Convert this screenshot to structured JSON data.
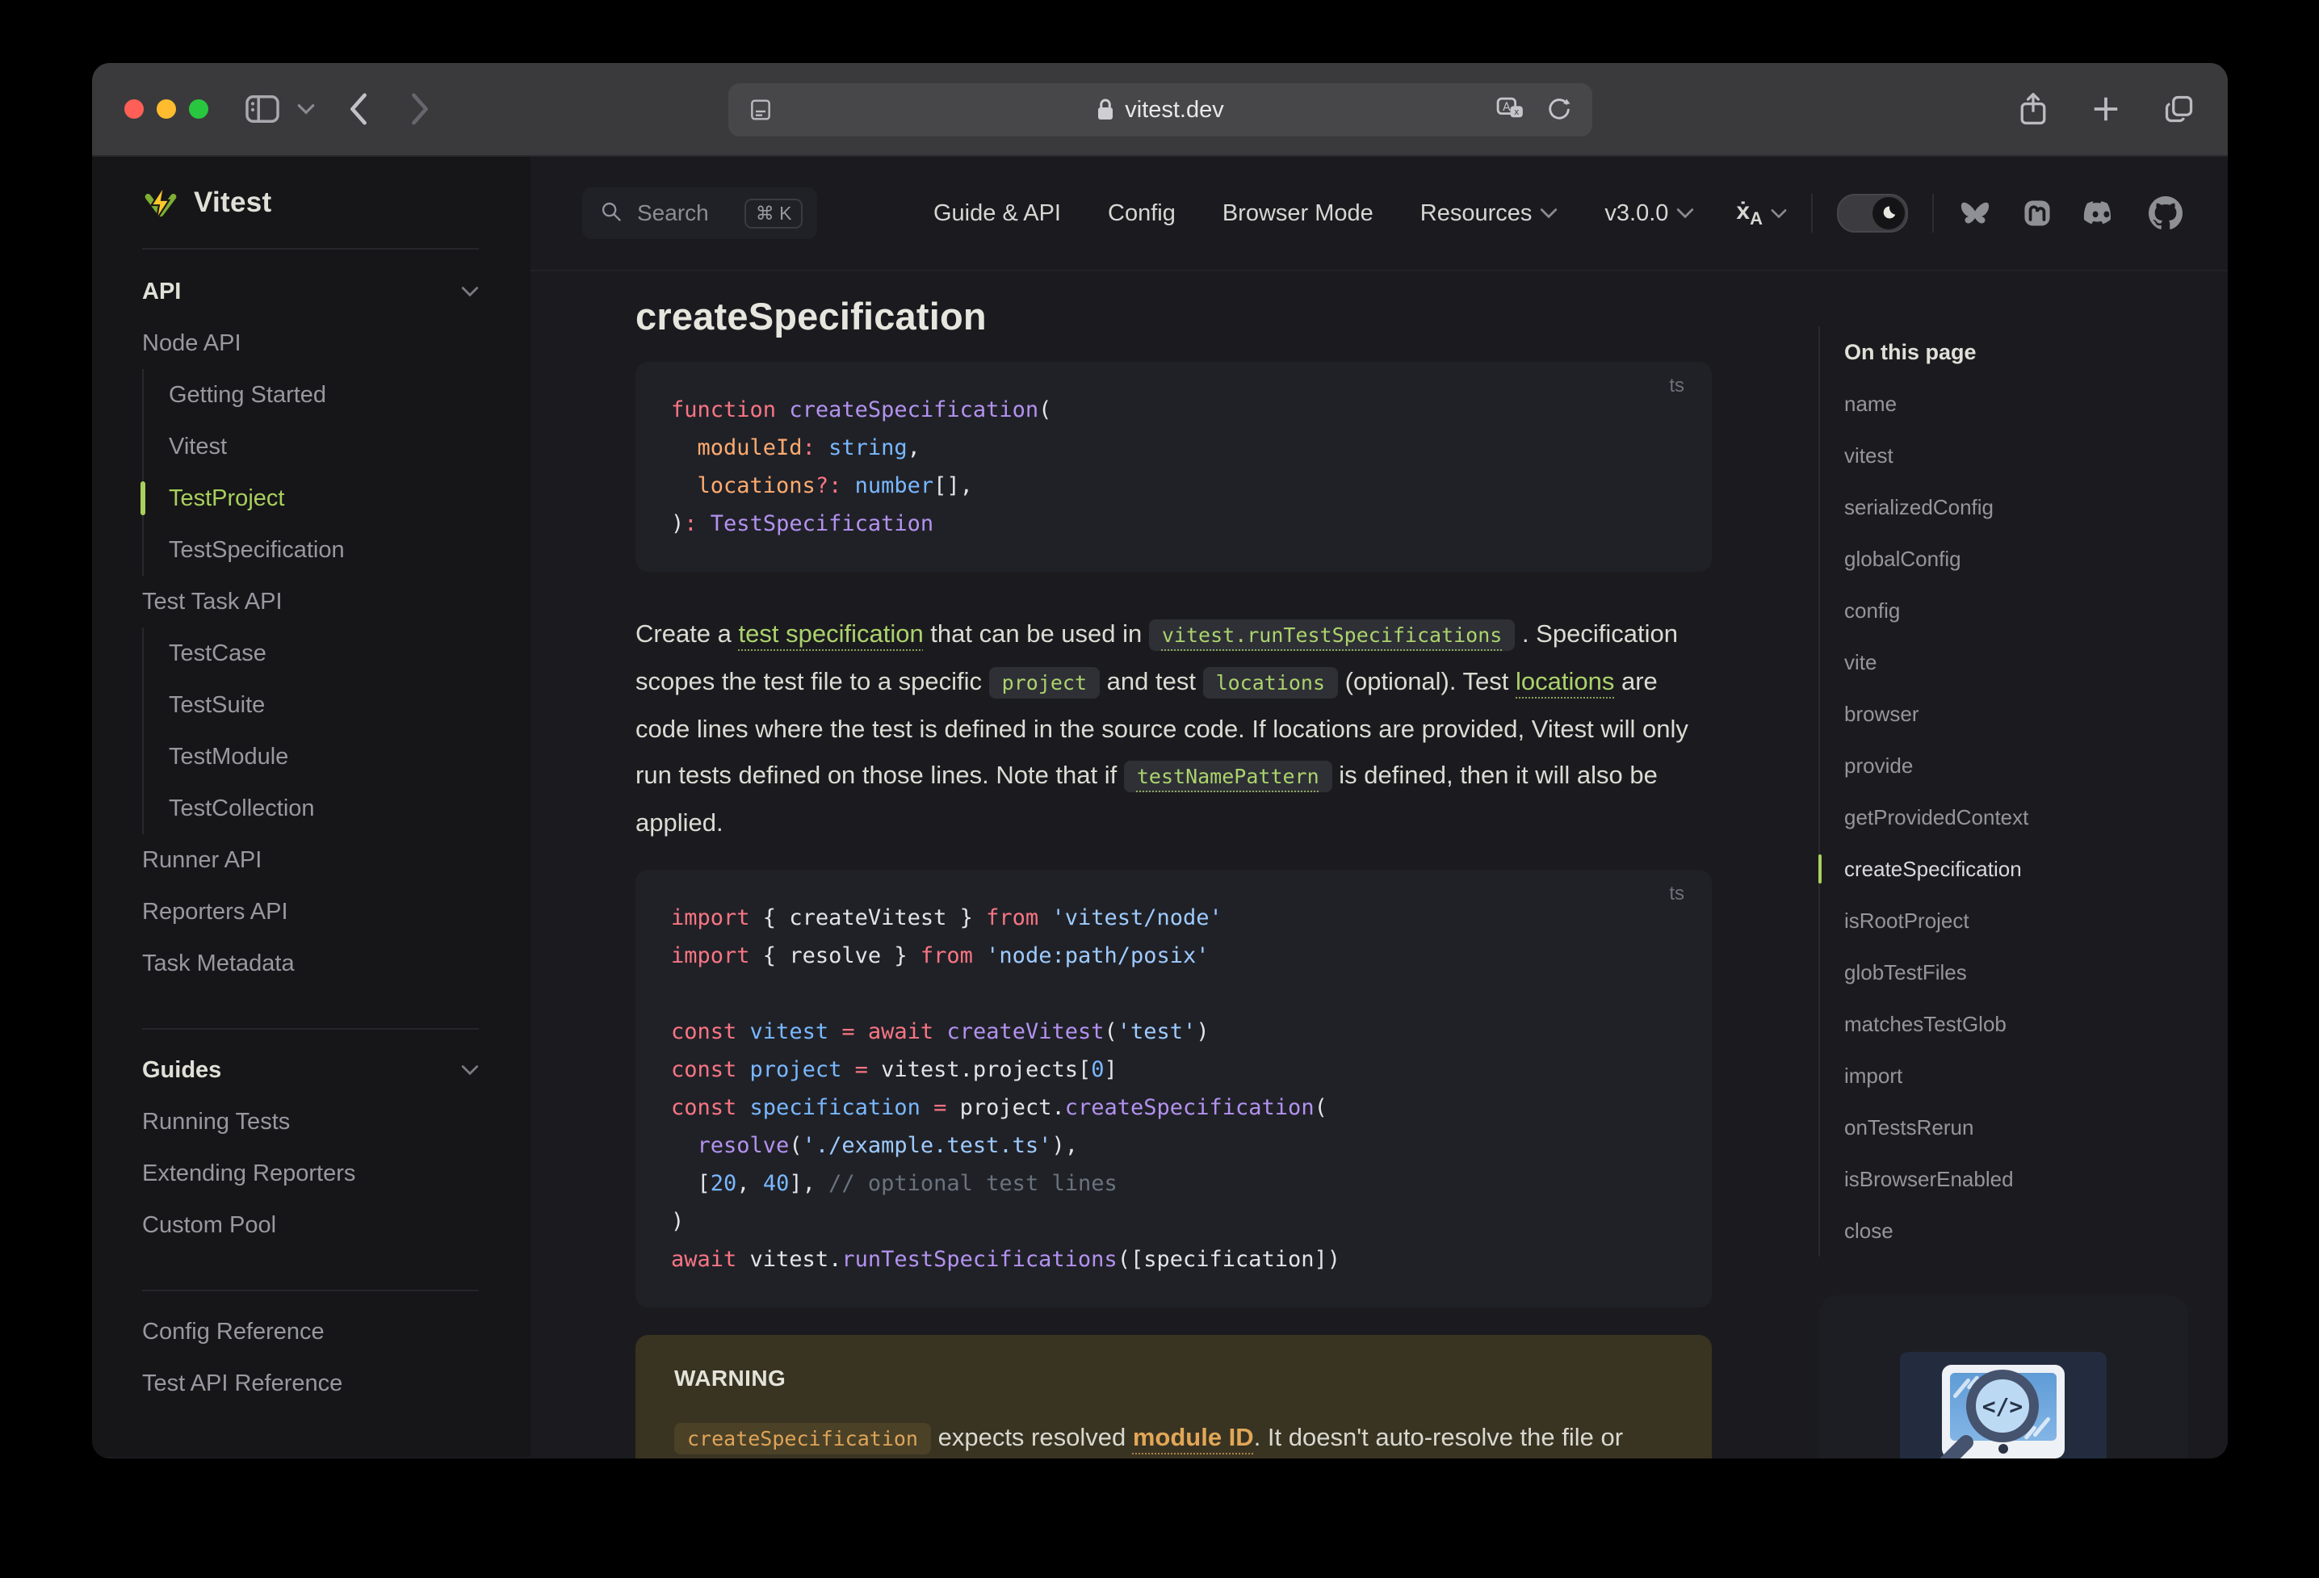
{
  "colors": {
    "brand": "#a8d05c",
    "brand_light": "#acd36c",
    "code_bg": "#202127",
    "warning_bg": "#393322",
    "warning_chip_bg": "#4a4127",
    "warning_text": "#dfa458",
    "link_orange": "#e1a757",
    "logo_yellow": "#fcc72b",
    "logo_green": "#7fae33"
  },
  "browser_chrome": {
    "url": "vitest.dev"
  },
  "site_header": {
    "search": {
      "label": "Search",
      "shortcut": "⌘ K"
    },
    "nav": [
      {
        "label": "Guide & API",
        "chevron": false
      },
      {
        "label": "Config",
        "chevron": false
      },
      {
        "label": "Browser Mode",
        "chevron": false
      },
      {
        "label": "Resources",
        "chevron": true
      },
      {
        "label": "v3.0.0",
        "chevron": true
      }
    ],
    "language_glyph": "ẋ",
    "language_sub": "A"
  },
  "sidebar": {
    "logo": "Vitest",
    "groups": [
      {
        "title": "API",
        "chevron": true,
        "items": [
          {
            "label": "Node API",
            "level": 0
          },
          {
            "label": "Getting Started",
            "level": 1
          },
          {
            "label": "Vitest",
            "level": 1
          },
          {
            "label": "TestProject",
            "level": 1,
            "active": true
          },
          {
            "label": "TestSpecification",
            "level": 1
          },
          {
            "label": "Test Task API",
            "level": 0
          },
          {
            "label": "TestCase",
            "level": 1
          },
          {
            "label": "TestSuite",
            "level": 1
          },
          {
            "label": "TestModule",
            "level": 1
          },
          {
            "label": "TestCollection",
            "level": 1
          },
          {
            "label": "Runner API",
            "level": 0
          },
          {
            "label": "Reporters API",
            "level": 0
          },
          {
            "label": "Task Metadata",
            "level": 0
          }
        ]
      },
      {
        "title": "Guides",
        "chevron": true,
        "items": [
          {
            "label": "Running Tests",
            "level": 0
          },
          {
            "label": "Extending Reporters",
            "level": 0
          },
          {
            "label": "Custom Pool",
            "level": 0
          }
        ]
      },
      {
        "title": "",
        "chevron": false,
        "items": [
          {
            "label": "Config Reference",
            "level": 0
          },
          {
            "label": "Test API Reference",
            "level": 0
          }
        ]
      }
    ]
  },
  "content": {
    "title": "createSpecification",
    "syntax_palette": {
      "keyword": "#f97583",
      "func": "#b392f0",
      "param": "#ffab70",
      "type": "#79b8ff",
      "string": "#9ecbff",
      "plain": "#e1e4e8",
      "comment": "#6a737d"
    },
    "code_block_1": {
      "lang": "ts",
      "lines": [
        [
          [
            "keyword",
            "function"
          ],
          [
            "plain",
            " "
          ],
          [
            "func",
            "createSpecification"
          ],
          [
            "plain",
            "("
          ]
        ],
        [
          [
            "plain",
            "  "
          ],
          [
            "param",
            "moduleId"
          ],
          [
            "keyword",
            ":"
          ],
          [
            "plain",
            " "
          ],
          [
            "type",
            "string"
          ],
          [
            "plain",
            ","
          ]
        ],
        [
          [
            "plain",
            "  "
          ],
          [
            "param",
            "locations"
          ],
          [
            "keyword",
            "?:"
          ],
          [
            "plain",
            " "
          ],
          [
            "type",
            "number"
          ],
          [
            "plain",
            "[],"
          ]
        ],
        [
          [
            "plain",
            ")"
          ],
          [
            "keyword",
            ":"
          ],
          [
            "plain",
            " "
          ],
          [
            "func",
            "TestSpecification"
          ]
        ]
      ]
    },
    "paragraph": [
      {
        "t": "text",
        "s": "Create a "
      },
      {
        "t": "link",
        "s": "test specification"
      },
      {
        "t": "text",
        "s": " that can be used in "
      },
      {
        "t": "codelink",
        "s": "vitest.runTestSpecifications"
      },
      {
        "t": "text",
        "s": " . Specification scopes the test file to a specific "
      },
      {
        "t": "code",
        "s": "project"
      },
      {
        "t": "text",
        "s": " and test "
      },
      {
        "t": "code",
        "s": "locations"
      },
      {
        "t": "text",
        "s": " (optional). Test "
      },
      {
        "t": "link",
        "s": "locations"
      },
      {
        "t": "text",
        "s": " are code lines where the test is defined in the source code. If locations are provided, Vitest will only run tests defined on those lines. Note that if "
      },
      {
        "t": "codelink",
        "s": "testNamePattern"
      },
      {
        "t": "text",
        "s": " is defined, then it will also be applied."
      }
    ],
    "code_block_2": {
      "lang": "ts",
      "lines": [
        [
          [
            "keyword",
            "import"
          ],
          [
            "plain",
            " { createVitest } "
          ],
          [
            "keyword",
            "from"
          ],
          [
            "plain",
            " "
          ],
          [
            "string",
            "'vitest/node'"
          ]
        ],
        [
          [
            "keyword",
            "import"
          ],
          [
            "plain",
            " { resolve } "
          ],
          [
            "keyword",
            "from"
          ],
          [
            "plain",
            " "
          ],
          [
            "string",
            "'node:path/posix'"
          ]
        ],
        [],
        [
          [
            "keyword",
            "const"
          ],
          [
            "plain",
            " "
          ],
          [
            "type",
            "vitest"
          ],
          [
            "plain",
            " "
          ],
          [
            "keyword",
            "="
          ],
          [
            "plain",
            " "
          ],
          [
            "keyword",
            "await"
          ],
          [
            "plain",
            " "
          ],
          [
            "func",
            "createVitest"
          ],
          [
            "plain",
            "("
          ],
          [
            "string",
            "'test'"
          ],
          [
            "plain",
            ")"
          ]
        ],
        [
          [
            "keyword",
            "const"
          ],
          [
            "plain",
            " "
          ],
          [
            "type",
            "project"
          ],
          [
            "plain",
            " "
          ],
          [
            "keyword",
            "="
          ],
          [
            "plain",
            " vitest.projects["
          ],
          [
            "type",
            "0"
          ],
          [
            "plain",
            "]"
          ]
        ],
        [
          [
            "keyword",
            "const"
          ],
          [
            "plain",
            " "
          ],
          [
            "type",
            "specification"
          ],
          [
            "plain",
            " "
          ],
          [
            "keyword",
            "="
          ],
          [
            "plain",
            " project."
          ],
          [
            "func",
            "createSpecification"
          ],
          [
            "plain",
            "("
          ]
        ],
        [
          [
            "plain",
            "  "
          ],
          [
            "func",
            "resolve"
          ],
          [
            "plain",
            "("
          ],
          [
            "string",
            "'./example.test.ts'"
          ],
          [
            "plain",
            "),"
          ]
        ],
        [
          [
            "plain",
            "  ["
          ],
          [
            "type",
            "20"
          ],
          [
            "plain",
            ", "
          ],
          [
            "type",
            "40"
          ],
          [
            "plain",
            "], "
          ],
          [
            "comment",
            "// optional test lines"
          ]
        ],
        [
          [
            "plain",
            ")"
          ]
        ],
        [
          [
            "keyword",
            "await"
          ],
          [
            "plain",
            " vitest."
          ],
          [
            "func",
            "runTestSpecifications"
          ],
          [
            "plain",
            "([specification])"
          ]
        ]
      ]
    },
    "warning": {
      "label": "WARNING",
      "body": [
        {
          "t": "code",
          "s": "createSpecification"
        },
        {
          "t": "text",
          "s": " expects resolved "
        },
        {
          "t": "olink",
          "s": "module ID"
        },
        {
          "t": "text",
          "s": ". It doesn't auto-resolve the file or check that it exists on the file system."
        }
      ]
    }
  },
  "aside": {
    "title": "On this page",
    "items": [
      {
        "label": "name"
      },
      {
        "label": "vitest"
      },
      {
        "label": "serializedConfig"
      },
      {
        "label": "globalConfig"
      },
      {
        "label": "config"
      },
      {
        "label": "vite"
      },
      {
        "label": "browser"
      },
      {
        "label": "provide"
      },
      {
        "label": "getProvidedContext"
      },
      {
        "label": "createSpecification",
        "active": true
      },
      {
        "label": "isRootProject"
      },
      {
        "label": "globTestFiles"
      },
      {
        "label": "matchesTestGlob"
      },
      {
        "label": "import"
      },
      {
        "label": "onTestsRerun"
      },
      {
        "label": "isBrowserEnabled"
      },
      {
        "label": "close"
      }
    ]
  }
}
